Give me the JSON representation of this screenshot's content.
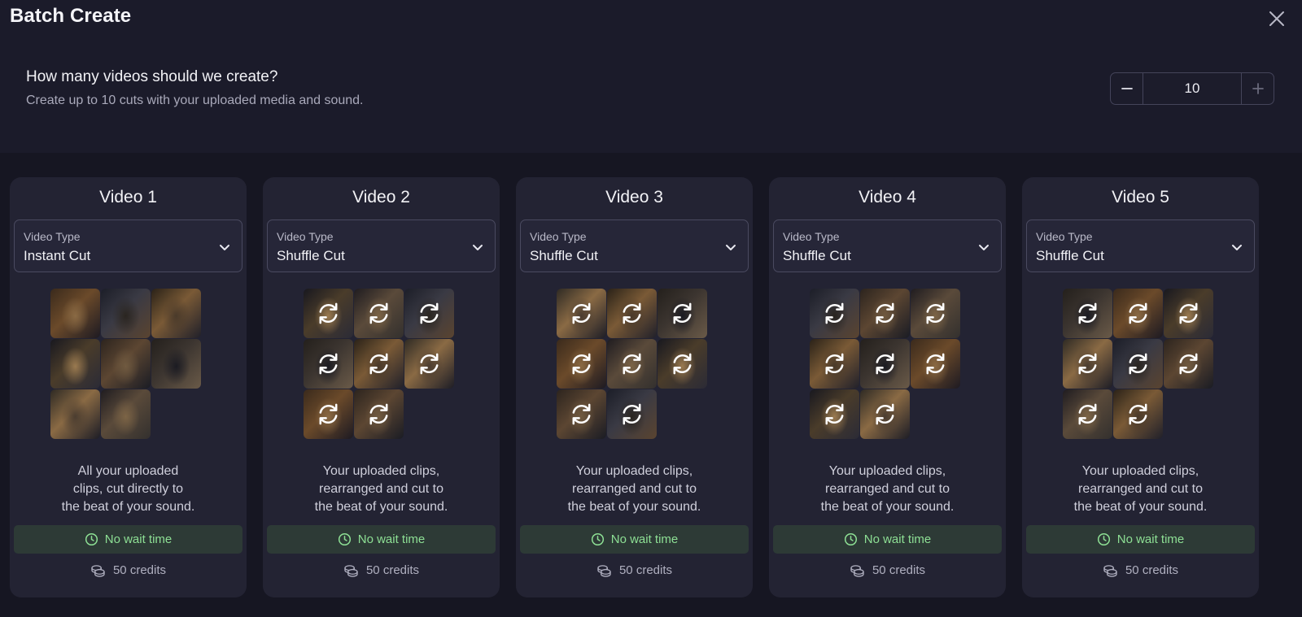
{
  "modal": {
    "title": "Batch Create"
  },
  "question": {
    "title": "How many videos should we create?",
    "subtitle": "Create up to 10 cuts with your uploaded media and sound.",
    "count": "10"
  },
  "select_label": "Video Type",
  "badges": {
    "wait": "No wait time",
    "credits": "50 credits"
  },
  "colors": {
    "accent_green": "#8ddf94",
    "card_bg": "#232333",
    "page_bg": "#161622"
  },
  "videos": [
    {
      "title": "Video 1",
      "type": "Instant Cut",
      "clip_count": 8,
      "shuffled": false,
      "desc": [
        "All your uploaded",
        "clips, cut directly to",
        "the beat of your sound."
      ]
    },
    {
      "title": "Video 2",
      "type": "Shuffle Cut",
      "clip_count": 8,
      "shuffled": true,
      "desc": [
        "Your uploaded clips,",
        "rearranged and cut to",
        "the beat of your sound."
      ]
    },
    {
      "title": "Video 3",
      "type": "Shuffle Cut",
      "clip_count": 8,
      "shuffled": true,
      "desc": [
        "Your uploaded clips,",
        "rearranged and cut to",
        "the beat of your sound."
      ]
    },
    {
      "title": "Video 4",
      "type": "Shuffle Cut",
      "clip_count": 8,
      "shuffled": true,
      "desc": [
        "Your uploaded clips,",
        "rearranged and cut to",
        "the beat of your sound."
      ]
    },
    {
      "title": "Video 5",
      "type": "Shuffle Cut",
      "clip_count": 8,
      "shuffled": true,
      "desc": [
        "Your uploaded clips,",
        "rearranged and cut to",
        "the beat of your sound."
      ]
    }
  ]
}
